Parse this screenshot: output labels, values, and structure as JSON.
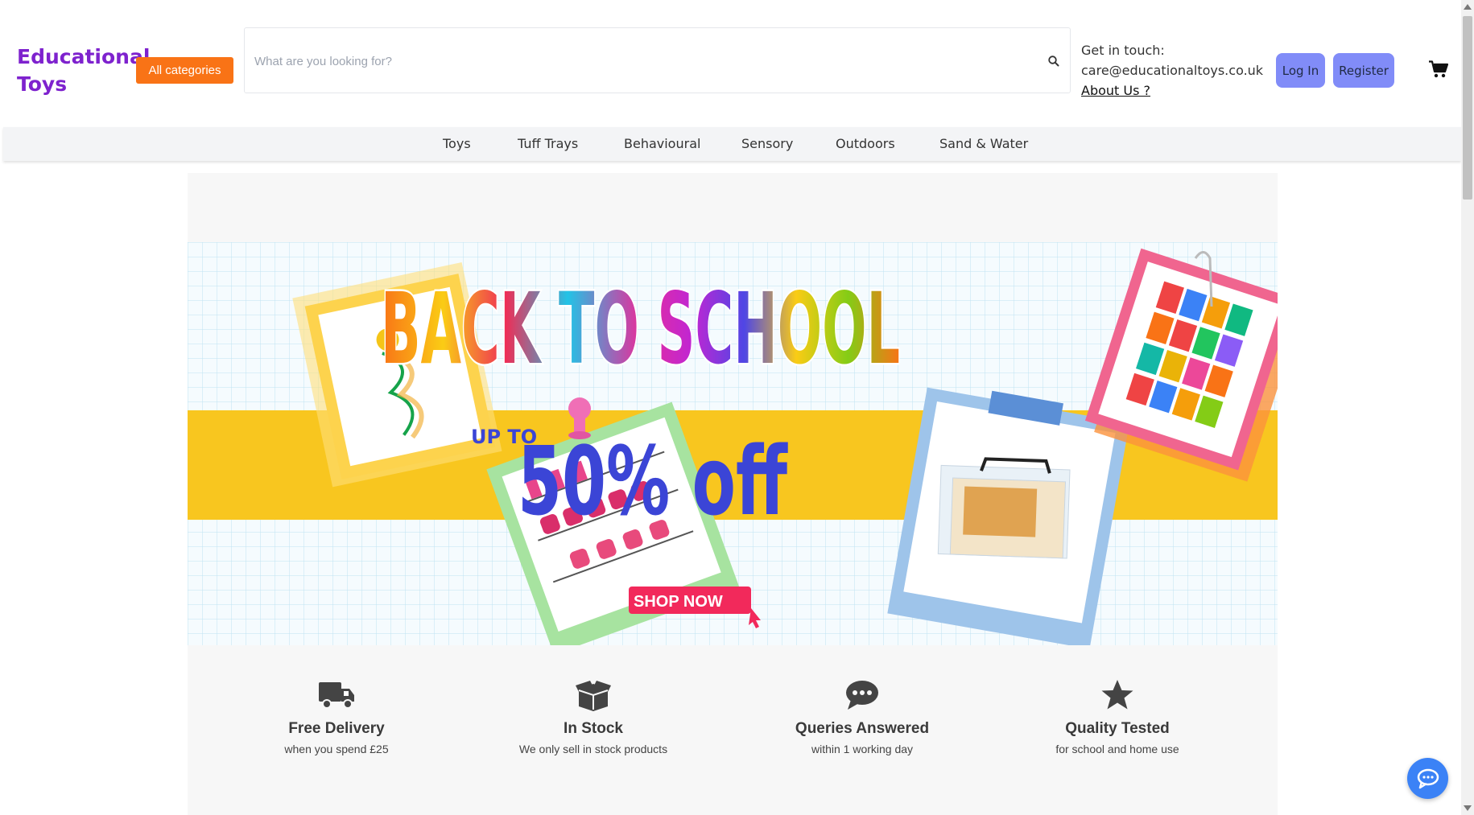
{
  "header": {
    "logo": "Educational Toys",
    "categories_button": "All categories",
    "search_placeholder": "What are you looking for?",
    "contact_label": "Get in touch:",
    "contact_email": "care@educationaltoys.co.uk",
    "about_link": "About Us ?",
    "login_label": "Log In",
    "register_label": "Register"
  },
  "nav": {
    "items": [
      "Toys",
      "Tuff Trays",
      "Behavioural",
      "Sensory",
      "Outdoors",
      "Sand & Water"
    ]
  },
  "banner": {
    "headline": "BACK TO SCHOOL",
    "promo_prefix": "UP TO",
    "promo": "50% off",
    "cta": "SHOP NOW"
  },
  "features": [
    {
      "icon": "truck-icon",
      "title": "Free Delivery",
      "subtitle": "when you spend £25"
    },
    {
      "icon": "box-icon",
      "title": "In Stock",
      "subtitle": "We only sell in stock products"
    },
    {
      "icon": "chat-bubble-icon",
      "title": "Queries Answered",
      "subtitle": "within 1 working day"
    },
    {
      "icon": "star-icon",
      "title": "Quality Tested",
      "subtitle": "for school and home use"
    }
  ],
  "colors": {
    "brand": "#7e22ce",
    "accent_orange": "#f97316",
    "button_blue": "#818cf8",
    "banner_yellow": "#f8c61f",
    "promo_blue": "#3b45d6",
    "cta_pink": "#f2295b",
    "chat_blue": "#3b82f6"
  }
}
